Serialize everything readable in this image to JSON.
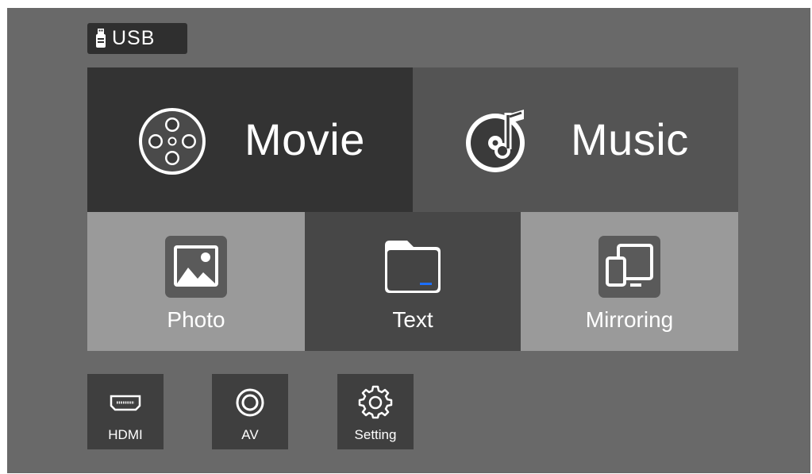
{
  "source": {
    "label": "USB",
    "icon": "usb-drive-icon"
  },
  "main_tiles": [
    {
      "label": "Movie",
      "icon": "film-reel-icon"
    },
    {
      "label": "Music",
      "icon": "music-disc-icon"
    }
  ],
  "media_tiles": [
    {
      "label": "Photo",
      "icon": "image-icon"
    },
    {
      "label": "Text",
      "icon": "folder-icon"
    },
    {
      "label": "Mirroring",
      "icon": "screen-mirroring-icon"
    }
  ],
  "input_buttons": [
    {
      "label": "HDMI",
      "icon": "hdmi-port-icon"
    },
    {
      "label": "AV",
      "icon": "av-jack-icon"
    },
    {
      "label": "Setting",
      "icon": "gear-icon"
    }
  ],
  "colors": {
    "background": "#696969",
    "movie_tile": "#333333",
    "music_tile": "#545454",
    "light_tile": "#9a9a9a",
    "dark_tile": "#474747",
    "button": "#3f3f3f",
    "text": "#ffffff"
  }
}
